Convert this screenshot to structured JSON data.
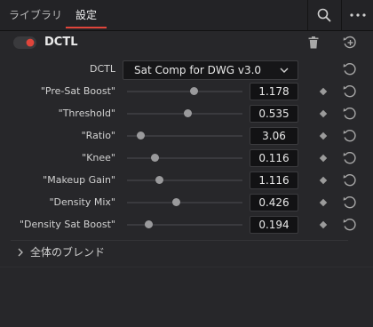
{
  "tabs": [
    {
      "label": "ライブラリ",
      "active": false
    },
    {
      "label": "設定",
      "active": true
    }
  ],
  "icons": {
    "search": "search-icon",
    "more": "more-icon",
    "trash": "trash-icon",
    "add_keyframe": "add-keyframe-icon",
    "reset": "reset-icon",
    "keyframe": "keyframe-diamond-icon",
    "toggle": "toggle-switch-icon",
    "expand": "chevron-right-icon",
    "dropdown": "chevron-down-icon"
  },
  "colors": {
    "accent": "#e0453b",
    "toggle_dot": "#e0453b"
  },
  "effect": {
    "title": "DCTL",
    "enabled": true
  },
  "dctl_select": {
    "label": "DCTL",
    "value": "Sat Comp for DWG v3.0"
  },
  "params": [
    {
      "label": "\"Pre-Sat Boost\"",
      "value": "1.178",
      "slider": 0.58
    },
    {
      "label": "\"Threshold\"",
      "value": "0.535",
      "slider": 0.53
    },
    {
      "label": "\"Ratio\"",
      "value": "3.06",
      "slider": 0.12
    },
    {
      "label": "\"Knee\"",
      "value": "0.116",
      "slider": 0.24
    },
    {
      "label": "\"Makeup Gain\"",
      "value": "1.116",
      "slider": 0.28
    },
    {
      "label": "\"Density Mix\"",
      "value": "0.426",
      "slider": 0.43
    },
    {
      "label": "\"Density Sat Boost\"",
      "value": "0.194",
      "slider": 0.19
    }
  ],
  "section": {
    "label": "全体のブレンド"
  }
}
